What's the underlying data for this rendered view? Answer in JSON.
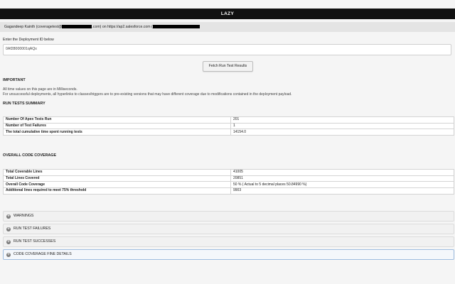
{
  "app": {
    "title": "LAZY"
  },
  "user": {
    "prefix": "Gagandeep Kainth (coveragetest@",
    "middle": ".com) on https://ap2.salesforce.com ("
  },
  "deploy": {
    "label": "Enter the Deployment ID below",
    "value": "0Af28000001qAQx",
    "button": "Fetch Run Test Results"
  },
  "important": {
    "heading": "IMPORTANT",
    "line1": "All time values on this page are in Milliseconds.",
    "line2": "For unsuccessful deployments, all hyperlinks to classes/triggers are to pre-existing versions that may have different coverage due to modifications contained in the deployment payload."
  },
  "run_summary": {
    "heading": "RUN TESTS SUMMARY",
    "rows": [
      {
        "label": "Number Of Apex Tests Run",
        "value": "201"
      },
      {
        "label": "Number of Test Failures",
        "value": "1"
      },
      {
        "label": "The total cumulative time spent running tests",
        "value": "14154.0"
      }
    ]
  },
  "coverage": {
    "heading": "OVERALL CODE COVERAGE",
    "rows": [
      {
        "label": "Total Coverable Lines",
        "value": "41005"
      },
      {
        "label": "Total Lines Covered",
        "value": "20851"
      },
      {
        "label": "Overall Code Coverage",
        "value": "50 % ( Actual to 5 decimal places 50.84990 %)"
      },
      {
        "label": "Additional lines required to meet 75% threshold",
        "value": "9903"
      }
    ]
  },
  "sections": [
    {
      "label": "WARNINGS"
    },
    {
      "label": "RUN TEST FAILURES"
    },
    {
      "label": "RUN TEST SUCCESSES"
    },
    {
      "label": "CODE COVERAGE FINE DETAILS"
    }
  ],
  "icons": {
    "accordion": "plus-circle-icon"
  }
}
